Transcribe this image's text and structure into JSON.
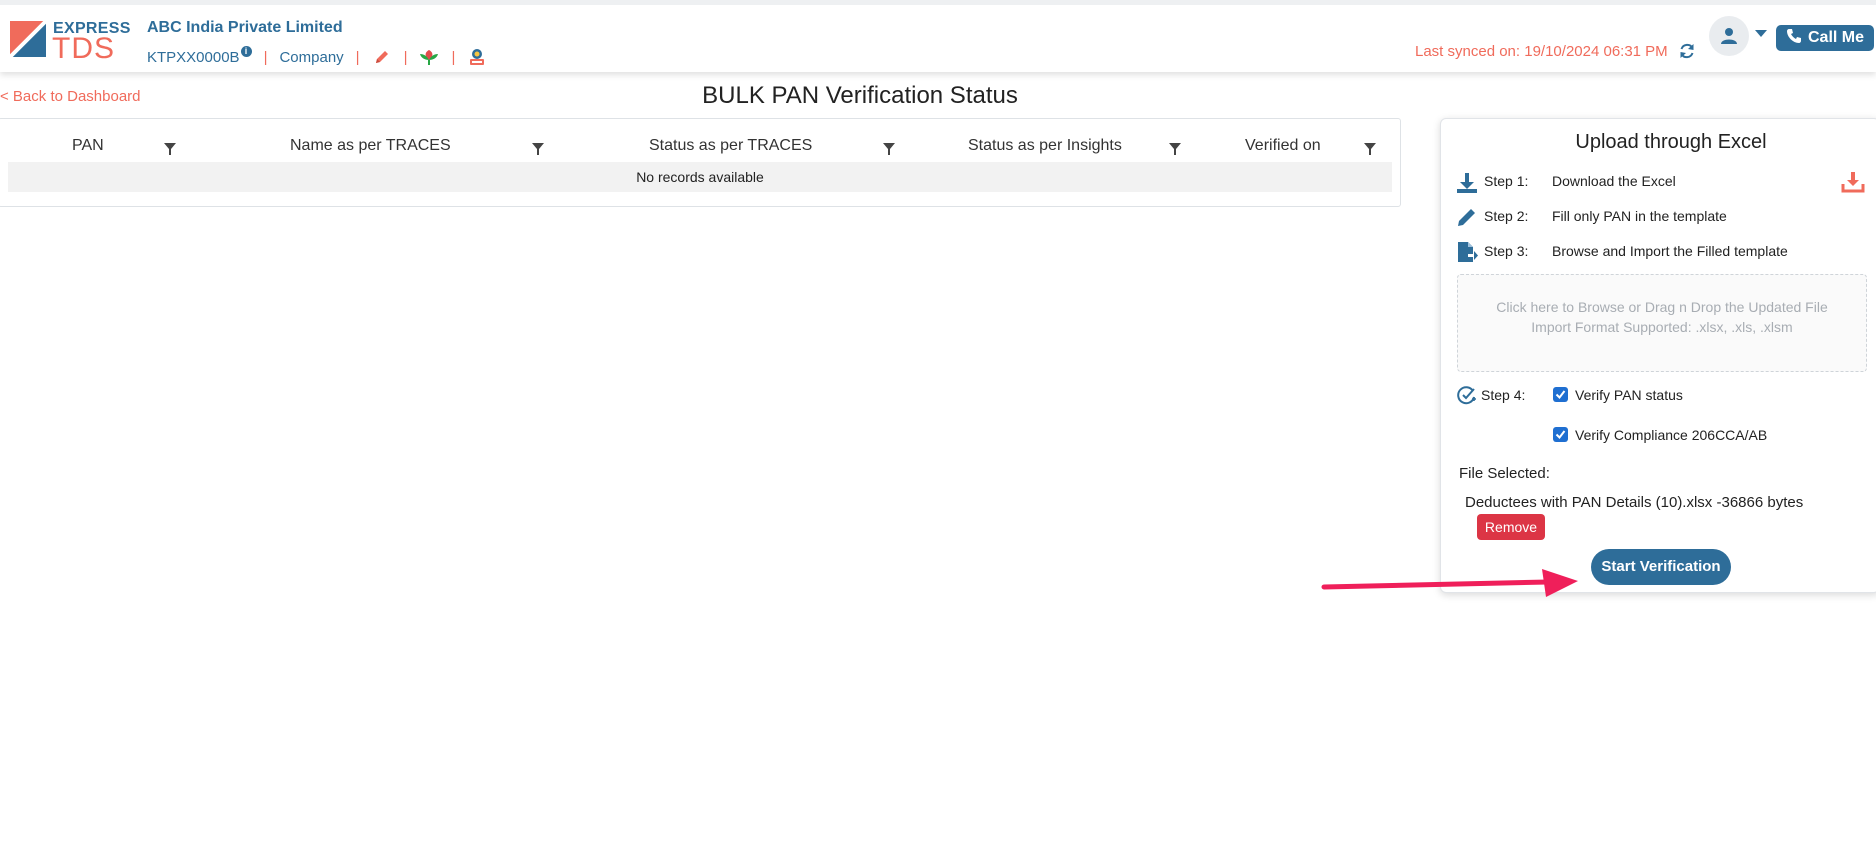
{
  "brand": {
    "logo_express": "EXPRESS",
    "logo_tds": "TDS"
  },
  "header": {
    "company_name": "ABC India Private Limited",
    "pan": "KTPXX0000B",
    "info_badge": "i",
    "separator": "|",
    "company_type": "Company",
    "last_synced": "Last synced on: 19/10/2024 06:31 PM",
    "call_me": "Call Me",
    "icons": [
      "pencil-icon",
      "leaf-icon",
      "certificate-icon",
      "sync-icon",
      "user-icon",
      "phone-icon"
    ]
  },
  "page": {
    "back_link": "< Back to Dashboard",
    "title": "BULK PAN Verification Status"
  },
  "table": {
    "columns": [
      "PAN",
      "Name as per TRACES",
      "Status as per TRACES",
      "Status as per Insights",
      "Verified on"
    ],
    "empty_message": "No records available"
  },
  "upload": {
    "title": "Upload through Excel",
    "steps": [
      {
        "label": "Step 1:",
        "text": "Download the Excel",
        "icon": "download-icon"
      },
      {
        "label": "Step 2:",
        "text": "Fill only PAN in the template",
        "icon": "pencil-icon"
      },
      {
        "label": "Step 3:",
        "text": "Browse and Import the Filled template",
        "icon": "file-import-icon"
      },
      {
        "label": "Step 4:",
        "icon": "check-circle-icon"
      }
    ],
    "dropzone_line1": "Click here to Browse or Drag n Drop the Updated File",
    "dropzone_line2": "Import Format Supported: .xlsx, .xls, .xlsm",
    "options": [
      {
        "label": "Verify PAN status",
        "checked": true
      },
      {
        "label": "Verify Compliance 206CCA/AB",
        "checked": true
      }
    ],
    "file_selected_label": "File Selected:",
    "file_name": "Deductees with PAN Details (10).xlsx -36866 bytes",
    "remove_label": "Remove",
    "start_label": "Start Verification"
  },
  "colors": {
    "primary": "#2e6d99",
    "accent": "#f06b5b",
    "danger": "#dc3545",
    "arrow": "#ef1f5a",
    "checkbox": "#1f6fd1"
  }
}
